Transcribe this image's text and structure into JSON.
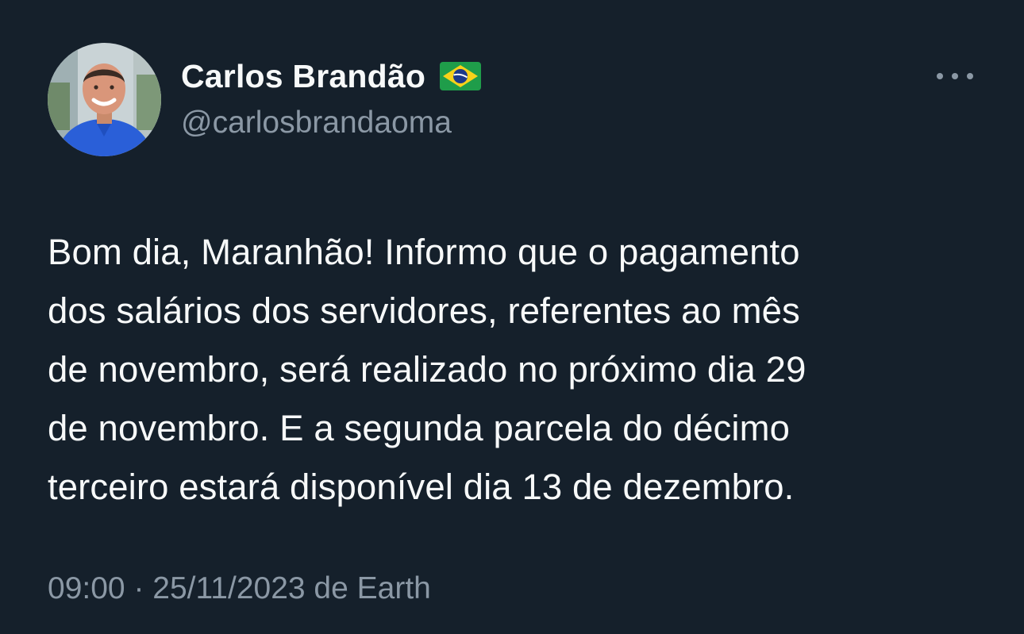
{
  "tweet": {
    "author": {
      "display_name": "Carlos Brandão",
      "flag_icon": "brazil-flag-icon",
      "handle": "@carlosbrandaoma"
    },
    "more_icon": "more-horizontal-icon",
    "text_lines": [
      "Bom dia, Maranhão! Informo que o pagamento",
      "dos salários dos servidores, referentes ao mês",
      "de novembro, será realizado no próximo dia 29",
      "de novembro. E a segunda parcela do décimo",
      "terceiro estará disponível dia 13 de dezembro."
    ],
    "meta": {
      "time": "09:00",
      "separator": " · ",
      "date": "25/11/2023",
      "via": " de ",
      "source": "Earth"
    }
  },
  "colors": {
    "background": "#15202b",
    "primary_text": "#f7f9f9",
    "secondary_text": "#8b98a5"
  }
}
